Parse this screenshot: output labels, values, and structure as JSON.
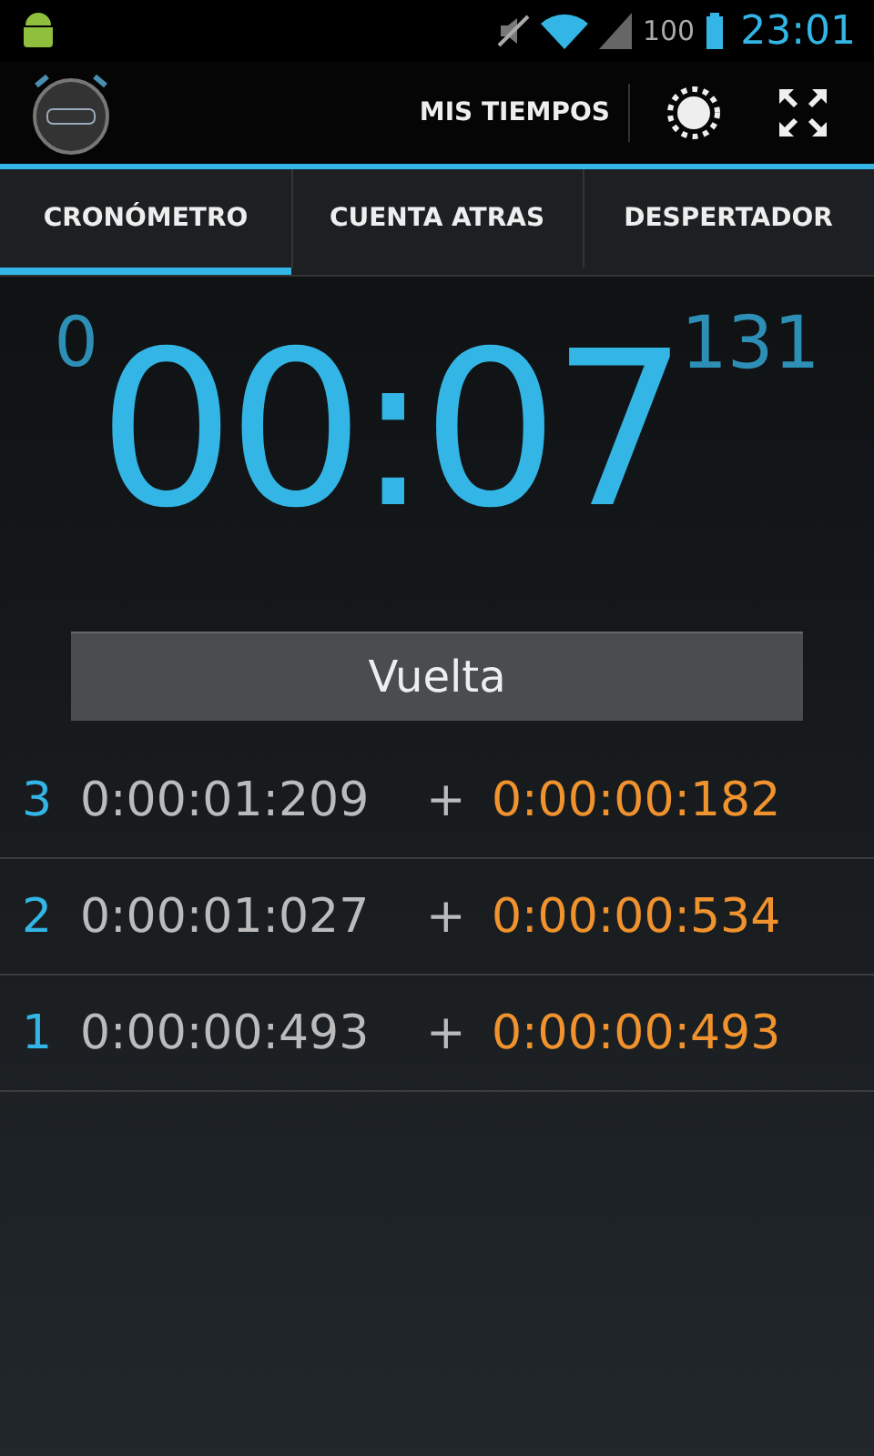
{
  "status_bar": {
    "battery": "100",
    "time": "23:01"
  },
  "action_bar": {
    "action": "MIS TIEMPOS"
  },
  "tabs": [
    {
      "label": "CRONÓMETRO",
      "selected": true
    },
    {
      "label": "CUENTA ATRAS",
      "selected": false
    },
    {
      "label": "DESPERTADOR",
      "selected": false
    }
  ],
  "timer": {
    "hours": "0",
    "time": "00:07",
    "millis": "131"
  },
  "lap_button": "Vuelta",
  "laps": [
    {
      "number": "3",
      "total": "0:00:01:209",
      "sign": "+",
      "split": "0:00:00:182"
    },
    {
      "number": "2",
      "total": "0:00:01:027",
      "sign": "+",
      "split": "0:00:00:534"
    },
    {
      "number": "1",
      "total": "0:00:00:493",
      "sign": "+",
      "split": "0:00:00:493"
    }
  ]
}
